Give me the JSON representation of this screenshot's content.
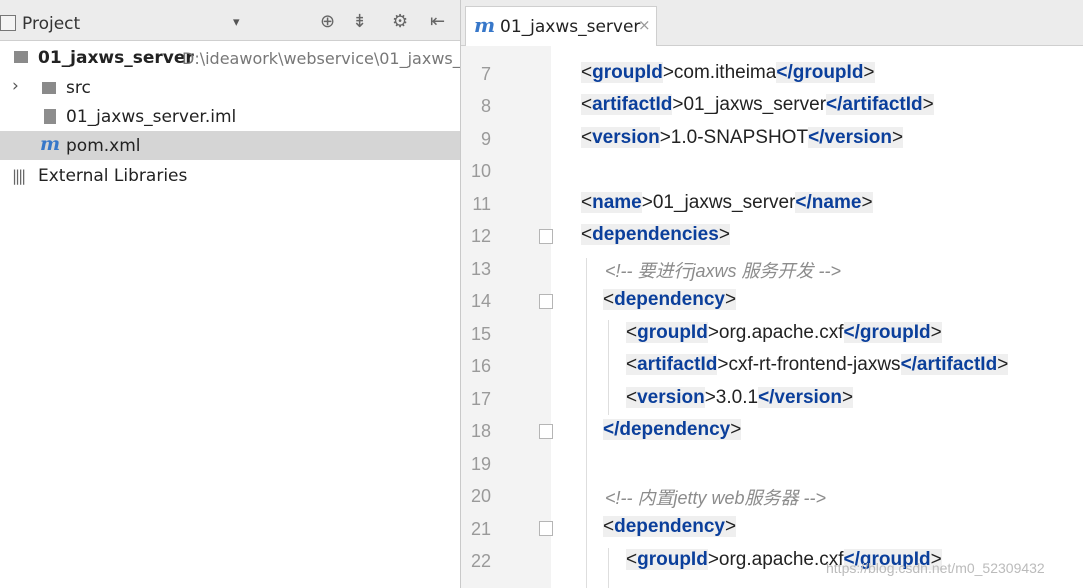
{
  "project_panel": {
    "title": "Project",
    "dropdown": "▾",
    "toolbar_icons": [
      "locate-icon",
      "collapse-icon",
      "gear-icon",
      "hide-panel-icon"
    ],
    "root": {
      "name": "01_jaxws_server",
      "path": "D:\\ideawork\\webservice\\01_jaxws_"
    },
    "items": [
      {
        "label": "src"
      },
      {
        "label": "01_jaxws_server.iml"
      },
      {
        "label": "pom.xml"
      },
      {
        "label": "External Libraries"
      }
    ]
  },
  "editor": {
    "tab_label": "01_jaxws_server",
    "tab_close": "×",
    "tab_icon": "m",
    "line_numbers": [
      "7",
      "8",
      "9",
      "10",
      "11",
      "12",
      "13",
      "14",
      "15",
      "16",
      "17",
      "18",
      "19",
      "20",
      "21",
      "22"
    ],
    "lines": [
      {
        "open": "<",
        "tag": "groupId",
        "mid": ">com.itheima",
        "ctag": "</groupId",
        "end": ">"
      },
      {
        "open": "<",
        "tag": "artifactId",
        "mid": ">01_jaxws_server",
        "ctag": "</artifactId",
        "end": ">"
      },
      {
        "open": "<",
        "tag": "version",
        "mid": ">1.0-SNAPSHOT",
        "ctag": "</version",
        "end": ">"
      },
      {
        "blank": true
      },
      {
        "open": "<",
        "tag": "name",
        "mid": ">01_jaxws_server",
        "ctag": "</name",
        "end": ">"
      },
      {
        "open": "<",
        "tag": "dependencies",
        "mid": ">",
        "ctag": "",
        "end": ""
      },
      {
        "comment": "<!-- 要进行jaxws 服务开发 -->"
      },
      {
        "open": "<",
        "tag": "dependency",
        "mid": ">",
        "ctag": "",
        "end": ""
      },
      {
        "open": "<",
        "tag": "groupId",
        "mid": ">org.apache.cxf",
        "ctag": "</groupId",
        "end": ">"
      },
      {
        "open": "<",
        "tag": "artifactId",
        "mid": ">cxf-rt-frontend-jaxws",
        "ctag": "</artifactId",
        "end": ">"
      },
      {
        "open": "<",
        "tag": "version",
        "mid": ">3.0.1",
        "ctag": "</version",
        "end": ">"
      },
      {
        "open": "",
        "tag": "</dependency",
        "mid": ">",
        "ctag": "",
        "end": ""
      },
      {
        "blank": true
      },
      {
        "comment": "<!-- 内置jetty web服务器  -->"
      },
      {
        "open": "<",
        "tag": "dependency",
        "mid": ">",
        "ctag": "",
        "end": ""
      },
      {
        "open": "<",
        "tag": "groupId",
        "mid": ">org.apache.cxf",
        "ctag": "</groupId",
        "end": ">"
      }
    ]
  },
  "watermark": "https://blog.csdn.net/m0_52309432"
}
